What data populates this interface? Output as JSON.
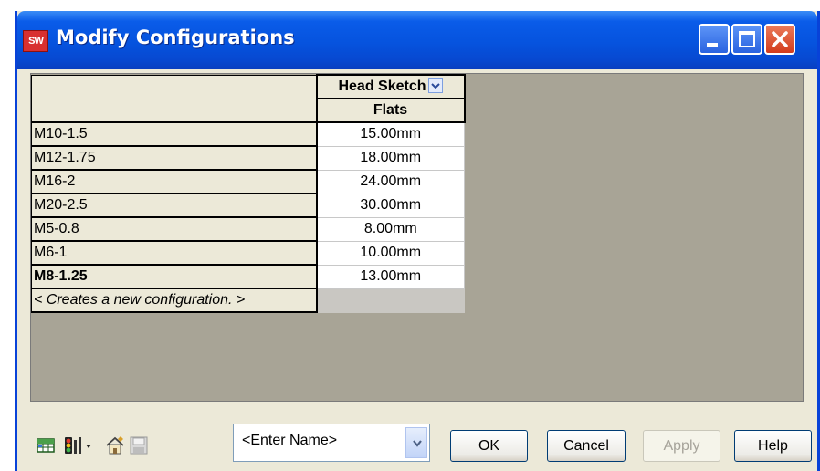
{
  "window": {
    "title": "Modify Configurations",
    "logo_text": "SW"
  },
  "table": {
    "column_header": "Head Sketch",
    "subheader": "Flats",
    "rows": [
      {
        "name": "M10-1.5",
        "value": "15.00mm",
        "bold": false
      },
      {
        "name": "M12-1.75",
        "value": "18.00mm",
        "bold": false
      },
      {
        "name": "M16-2",
        "value": "24.00mm",
        "bold": false
      },
      {
        "name": "M20-2.5",
        "value": "30.00mm",
        "bold": false
      },
      {
        "name": "M5-0.8",
        "value": "8.00mm",
        "bold": false
      },
      {
        "name": "M6-1",
        "value": "10.00mm",
        "bold": false
      },
      {
        "name": "M8-1.25",
        "value": "13.00mm",
        "bold": true
      }
    ],
    "new_row_label": "< Creates a new configuration. >"
  },
  "bottom": {
    "combo_value": "<Enter Name>",
    "buttons": {
      "ok": "OK",
      "cancel": "Cancel",
      "apply": "Apply",
      "help": "Help"
    }
  },
  "icons": [
    "table-view-icon",
    "traffic-light-icon",
    "dropdown-arrow-icon",
    "properties-icon",
    "save-icon"
  ],
  "colors": {
    "titlebar": "#0653de",
    "panel_bg": "#a8a496",
    "dialog_bg": "#ece9d8"
  }
}
